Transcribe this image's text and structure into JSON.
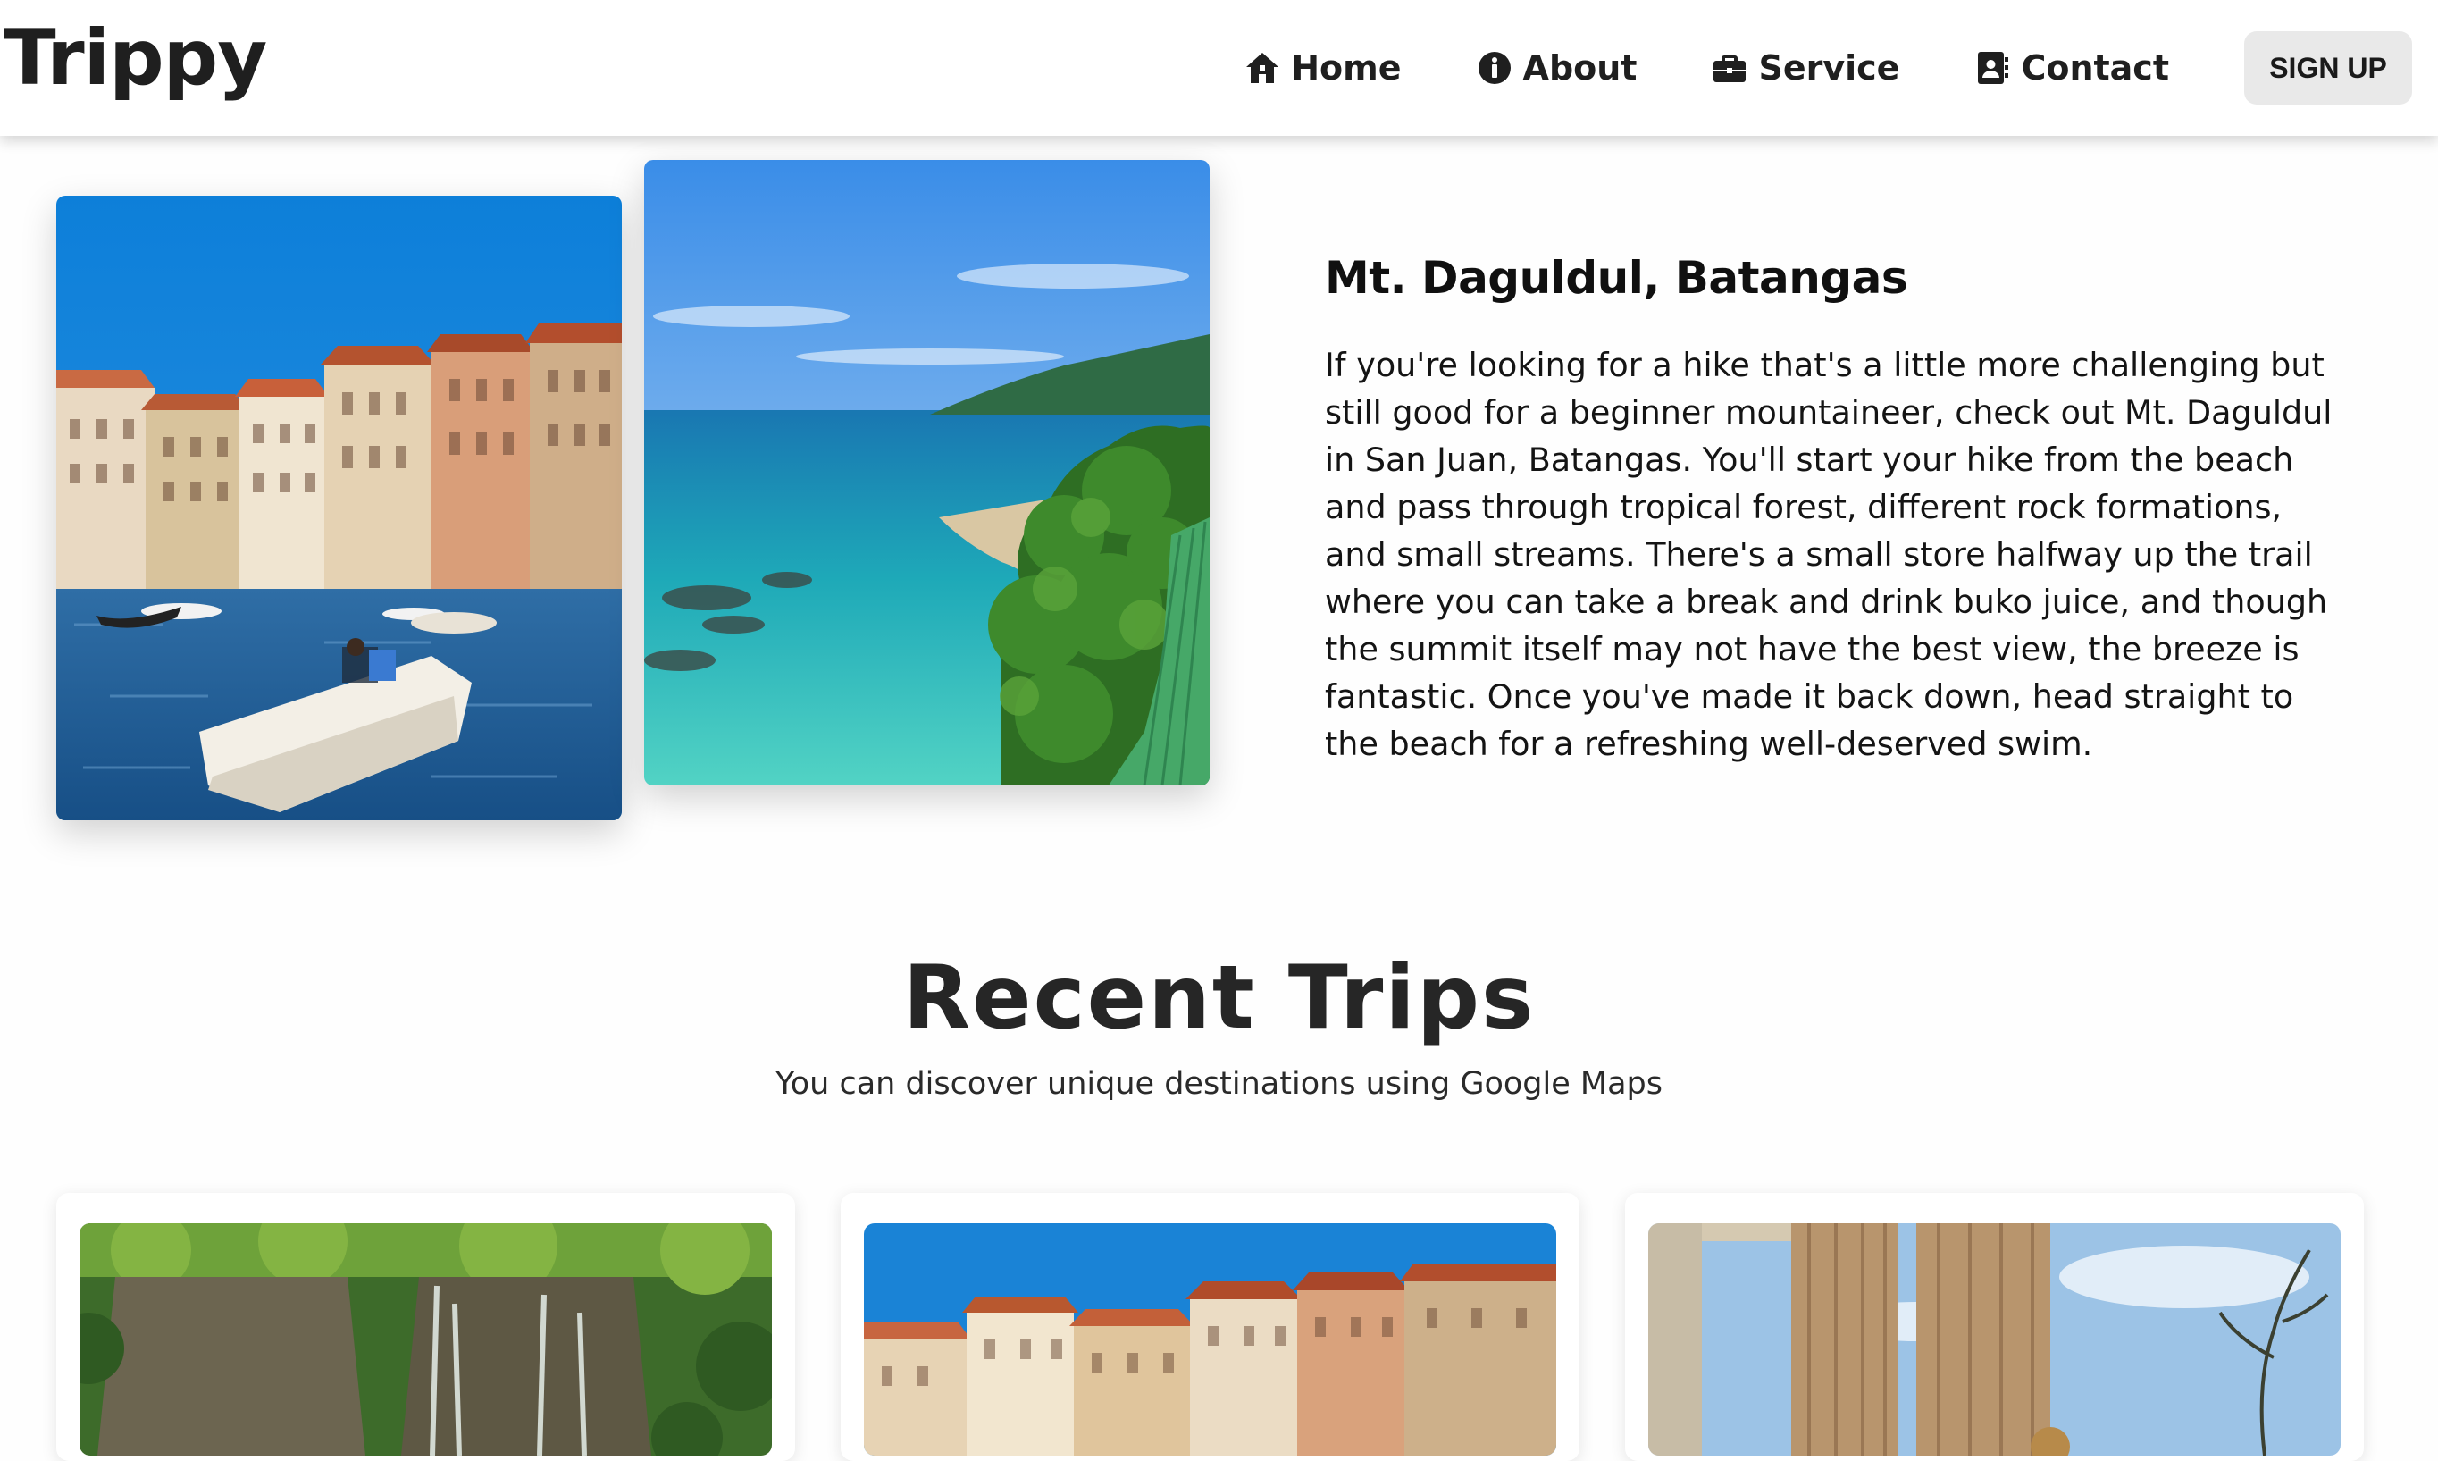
{
  "brand": {
    "name": "Trippy"
  },
  "nav": {
    "items": [
      {
        "label": "Home",
        "icon": "house-icon"
      },
      {
        "label": "About",
        "icon": "info-circle-icon"
      },
      {
        "label": "Service",
        "icon": "briefcase-icon"
      },
      {
        "label": "Contact",
        "icon": "address-book-icon"
      }
    ],
    "signup_label": "SIGN UP"
  },
  "destination": {
    "title": "Mt. Daguldul, Batangas",
    "description": "If you're looking for a hike that's a little more challenging but still good for a beginner mountaineer, check out Mt. Daguldul in San Juan, Batangas. You'll start your hike from the beach and pass through tropical forest, different rock formations, and small streams. There's a small store halfway up the trail where you can take a break and drink buko juice, and though the summit itself may not have the best view, the breeze is fantastic. Once you've made it back down, head straight to the beach for a refreshing well-deserved swim.",
    "images": [
      "venice-canal-photo",
      "tropical-coast-photo"
    ]
  },
  "recent_trips": {
    "title": "Recent Trips",
    "subtitle": "You can discover unique destinations using Google Maps",
    "cards": [
      {
        "image": "waterfall-forest-photo"
      },
      {
        "image": "venice-buildings-photo"
      },
      {
        "image": "greek-columns-photo"
      }
    ]
  },
  "colors": {
    "navbar_bg": "#ffffff",
    "page_bg": "#fefefe",
    "signup_bg": "#e9e9e9",
    "text_dark": "#1c1c1c"
  }
}
